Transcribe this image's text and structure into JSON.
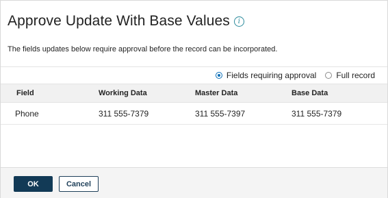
{
  "dialog": {
    "title": "Approve Update With Base Values",
    "info_glyph": "i",
    "description": "The fields updates below require approval before the record can be incorporated."
  },
  "view_options": [
    {
      "label": "Fields requiring approval",
      "selected": true
    },
    {
      "label": "Full record",
      "selected": false
    }
  ],
  "table": {
    "columns": [
      "Field",
      "Working Data",
      "Master Data",
      "Base Data"
    ],
    "rows": [
      [
        "Phone",
        "311 555-7379",
        "311 555-7397",
        "311 555-7379"
      ]
    ]
  },
  "footer": {
    "ok_label": "OK",
    "cancel_label": "Cancel"
  },
  "colors": {
    "primary_button": "#123a56",
    "accent": "#0b6fb8",
    "info_icon": "#2b8a9b"
  },
  "icons": {
    "info": "info-icon",
    "radio_selected": "radio-selected-icon",
    "radio_unselected": "radio-unselected-icon"
  }
}
